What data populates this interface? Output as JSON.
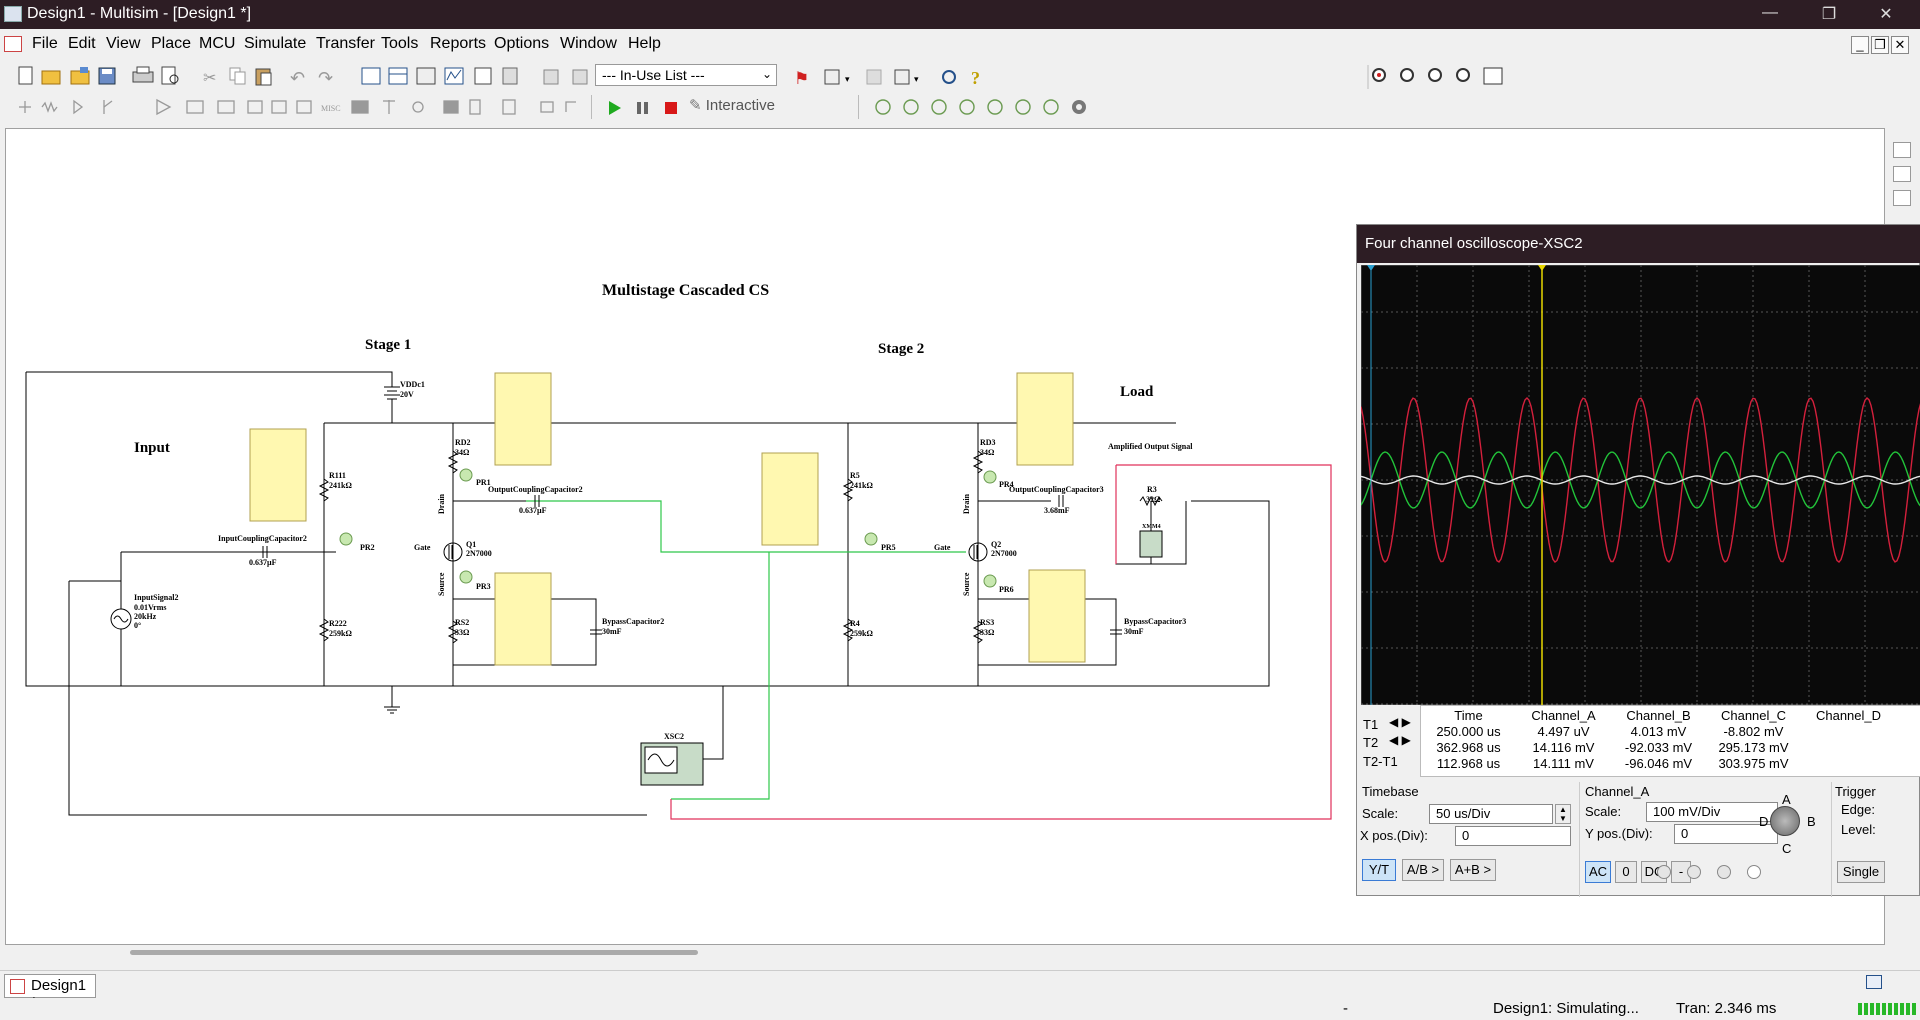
{
  "window": {
    "title": "Design1 - Multisim - [Design1 *]",
    "minimize": "—",
    "maximize": "❐",
    "close": "✕"
  },
  "menu": [
    "File",
    "Edit",
    "View",
    "Place",
    "MCU",
    "Simulate",
    "Transfer",
    "Tools",
    "Reports",
    "Options",
    "Window",
    "Help"
  ],
  "mdi": {
    "minimize": "_",
    "restore": "❐",
    "close": "✕"
  },
  "toolbar": {
    "in_use_list": "--- In-Use List ---",
    "interactive_label": "Interactive"
  },
  "schematic": {
    "title": "Multistage Cascaded CS",
    "stage1": "Stage 1",
    "stage2": "Stage 2",
    "input": "Input",
    "load": "Load",
    "amplified_output": "Amplified Output Signal",
    "vdd": "VDDc1",
    "vdd_val": "20V",
    "r111": "R111",
    "r111_val": "241kΩ",
    "r222": "R222",
    "r222_val": "259kΩ",
    "rd2": "RD2",
    "rd2_val": "34Ω",
    "rs2": "RS2",
    "rs2_val": "33Ω",
    "q1": "Q1",
    "q1_val": "2N7000",
    "q2": "Q2",
    "q2_val": "2N7000",
    "r5": "R5",
    "r5_val": "241kΩ",
    "r4": "R4",
    "r4_val": "259kΩ",
    "rd3": "RD3",
    "rd3_val": "34Ω",
    "rs3": "RS3",
    "rs3_val": "33Ω",
    "r3": "R3",
    "r3_val": "32Ω",
    "input_cap": "InputCouplingCapacitor2",
    "input_cap_val": "0.637µF",
    "output_cap2": "OutputCouplingCapacitor2",
    "output_cap2_val": "0.637µF",
    "output_cap3": "OutputCouplingCapacitor3",
    "output_cap3_val": "3.68mF",
    "bypass2": "BypassCapacitor2",
    "bypass2_val": "30mF",
    "bypass3": "BypassCapacitor3",
    "bypass3_val": "30mF",
    "signal": "InputSignal2",
    "signal_v": "0.01Vrms",
    "signal_f": "20kHz",
    "signal_p": "0°",
    "pr1": "PR1",
    "pr2": "PR2",
    "pr3": "PR3",
    "pr4": "PR4",
    "pr5": "PR5",
    "pr6": "PR6",
    "gate": "Gate",
    "drain": "Drain",
    "source": "Source",
    "xsc2": "XSC2",
    "xmm": "XMM4"
  },
  "scope": {
    "title": "Four channel oscilloscope-XSC2",
    "channel_a_color": "#d4203c",
    "channel_b_color": "#22c43a",
    "channel_c_color": "#e8e8e8",
    "columns": [
      "Time",
      "Channel_A",
      "Channel_B",
      "Channel_C",
      "Channel_D"
    ],
    "rows": [
      {
        "label": "T1",
        "time": "250.000 us",
        "a": "4.497 uV",
        "b": "4.013 mV",
        "c": "-8.802 mV",
        "d": ""
      },
      {
        "label": "T2",
        "time": "362.968 us",
        "a": "14.116 mV",
        "b": "-92.033 mV",
        "c": "295.173 mV",
        "d": ""
      },
      {
        "label": "T2-T1",
        "time": "112.968 us",
        "a": "14.111 mV",
        "b": "-96.046 mV",
        "c": "303.975 mV",
        "d": ""
      }
    ],
    "timebase_label": "Timebase",
    "scale_label": "Scale:",
    "timebase_scale": "50 us/Div",
    "xpos_label": "X pos.(Div):",
    "xpos": "0",
    "channel_a_label": "Channel_A",
    "ch_scale": "100 mV/Div",
    "ypos_label": "Y pos.(Div):",
    "ypos": "0",
    "trigger_label": "Trigger",
    "edge_label": "Edge:",
    "level_label": "Level:",
    "knob_a": "A",
    "knob_b": "B",
    "knob_c": "C",
    "knob_d": "D",
    "btn_yt": "Y/T",
    "btn_ab": "A/B >",
    "btn_apb": "A+B >",
    "btn_ac": "AC",
    "btn_zero": "0",
    "btn_dc": "DC",
    "btn_minus": "-",
    "btn_single": "Single"
  },
  "tabs": {
    "design1": "Design1 *"
  },
  "status": {
    "dash": "-",
    "simulating": "Design1: Simulating...",
    "tran": "Tran: 2.346 ms"
  }
}
